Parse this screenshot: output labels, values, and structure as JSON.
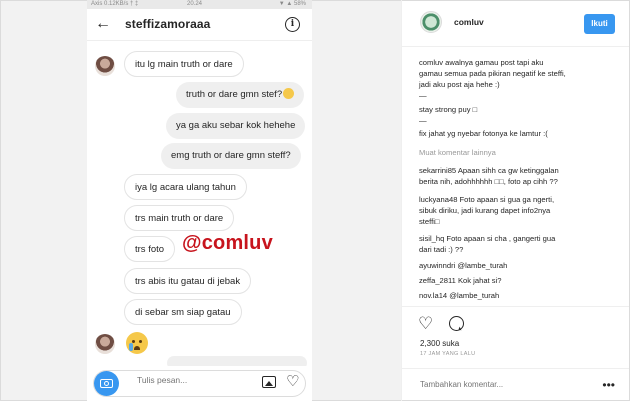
{
  "chat": {
    "status": {
      "left": "Axis 0.12KB/s † ‡",
      "time": "20.24",
      "right": "▼ ▲ 58%"
    },
    "title": "steffizamoraaa",
    "messages": [
      {
        "from": "them",
        "text": "itu lg main truth or dare"
      },
      {
        "from": "me",
        "text": "truth or dare gmn stef?"
      },
      {
        "from": "me",
        "text": "ya ga aku sebar kok hehehe"
      },
      {
        "from": "me",
        "text": "emg truth or dare gmn steff?"
      },
      {
        "from": "them",
        "text": "iya lg acara ulang tahun"
      },
      {
        "from": "them",
        "text": "trs main truth or dare"
      },
      {
        "from": "them",
        "text": "trs foto"
      },
      {
        "from": "them",
        "text": "trs abis itu gatau di jebak"
      },
      {
        "from": "them",
        "text": "di sebar sm siap gatau"
      }
    ],
    "watermark": "@comluv",
    "input_placeholder": "Tulis pesan..."
  },
  "post": {
    "username": "comluv",
    "follow_label": "Ikuti",
    "caption_lines": [
      "comluv awalnya gamau post tapi aku",
      "gamau semua pada pikiran negatif ke steffi,",
      "jadi aku post aja hehe :)",
      "—",
      "stay strong puy □",
      "—",
      "fix jahat yg nyebar fotonya ke lamtur :("
    ],
    "load_more": "Muat komentar lainnya",
    "comments": [
      [
        "sekarrini85 Apaan sihh ca gw ketinggalan",
        "berita nih, adohhhhhh □□, foto ap cihh ??"
      ],
      [
        "luckyana48 Foto apaan si gua ga ngerti,",
        "sibuk diriku, jadi kurang dapet info2nya",
        "steffi□"
      ],
      [
        "sisil_hq Foto apaan si cha , gangerti gua",
        "dari tadi :) ??"
      ],
      [
        "ayuwinndri @lambe_turah"
      ],
      [
        "zeffa_2811 Kok jahat si?"
      ],
      [
        "nov.la14 @lambe_turah"
      ]
    ],
    "likes": "2,300 suka",
    "time_ago": "17 JAM YANG LALU",
    "add_comment_placeholder": "Tambahkan komentar...",
    "more": "•••"
  },
  "colors": {
    "accent": "#3897f0",
    "watermark": "#c7141d",
    "bubble_out": "#efefef"
  }
}
